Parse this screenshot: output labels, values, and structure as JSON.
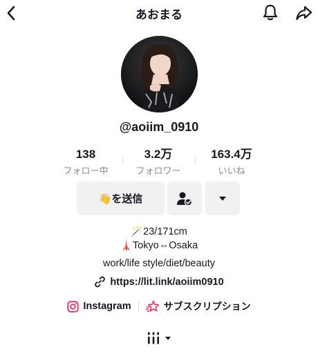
{
  "header": {
    "title": "あおまる"
  },
  "profile": {
    "username": "@aoiim_0910"
  },
  "stats": [
    {
      "value": "138",
      "label": "フォロー中"
    },
    {
      "value": "3.2万",
      "label": "フォロワー"
    },
    {
      "value": "163.4万",
      "label": "いいね"
    }
  ],
  "actions": {
    "message_label": "👋を送信"
  },
  "bio": {
    "line1": "🪄23/171cm",
    "line2": "🗼Tokyo⇔Osaka",
    "line3": "work/life style/diet/beauty",
    "link": "https://lit.link/aoiim0910"
  },
  "social": {
    "instagram": "Instagram",
    "subscription": "サブスクリプション"
  },
  "colors": {
    "text": "#161823",
    "muted": "#8a8b91",
    "button_bg": "#f1f1f2",
    "instagram": "#e1306c",
    "subscription": "#fe2c55"
  }
}
